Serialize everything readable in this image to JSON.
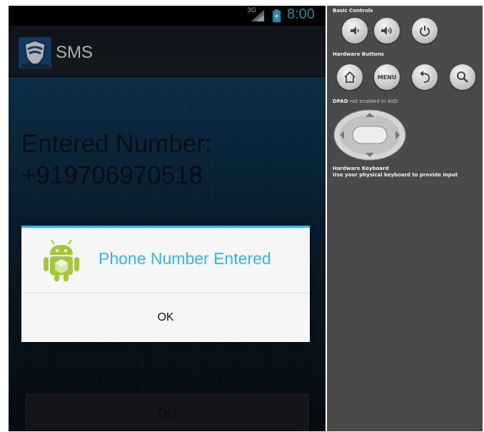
{
  "phone": {
    "status_bar": {
      "network": "3G",
      "time": "8:00"
    },
    "action_bar": {
      "title": "SMS"
    },
    "content": {
      "entered_label": "Entered Number:",
      "entered_number": "+919706970518",
      "on_button": "ON"
    },
    "dialog": {
      "title": "Phone Number Entered",
      "ok_label": "OK"
    }
  },
  "emulator_panel": {
    "basic_controls": {
      "heading": "Basic Controls",
      "buttons": [
        "volume-down-icon",
        "volume-up-icon",
        "power-icon"
      ]
    },
    "hardware_buttons": {
      "heading": "Hardware Buttons",
      "buttons": [
        "home-icon",
        "menu",
        "back-icon",
        "search-icon"
      ],
      "menu_label": "MENU"
    },
    "dpad": {
      "heading": "DPAD",
      "note": "not enabled in AVD"
    },
    "hardware_keyboard": {
      "heading": "Hardware Keyboard",
      "note": "Use your physical keyboard to provide input"
    }
  },
  "colors": {
    "accent": "#33b5e5",
    "panel_bg": "#4a4a4a",
    "android_green": "#a4c639"
  }
}
